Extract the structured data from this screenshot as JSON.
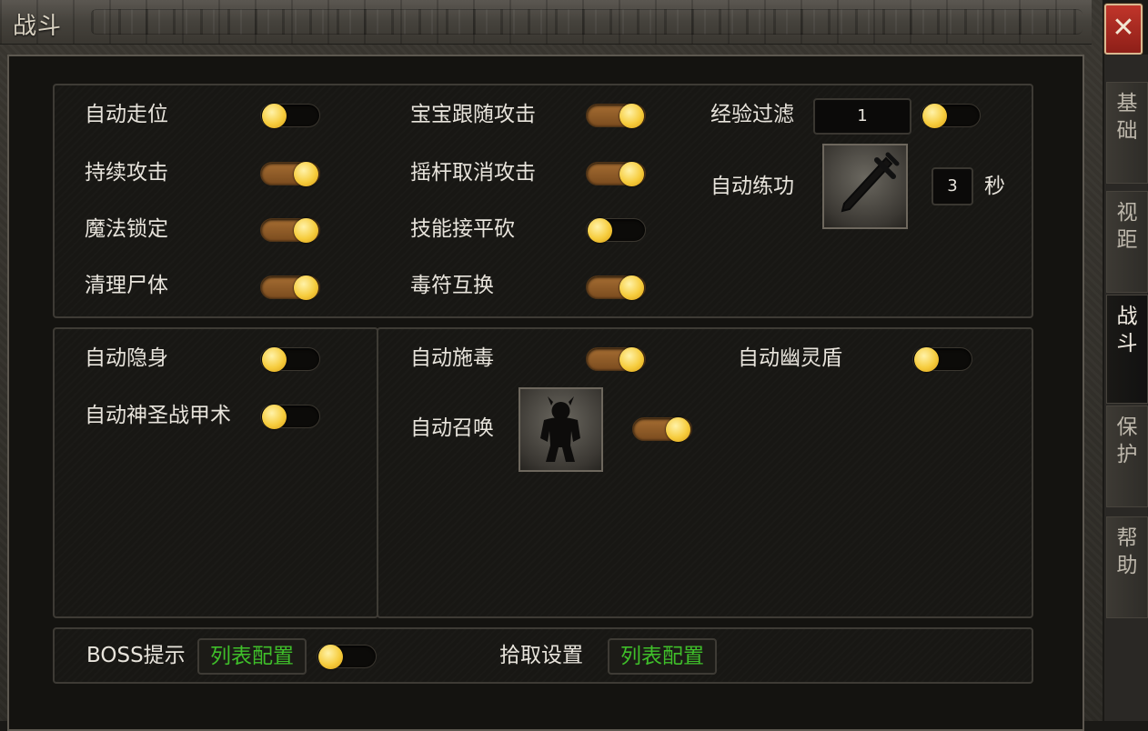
{
  "title": "战斗",
  "close_symbol": "✕",
  "side_tabs": [
    {
      "label": "基\n础",
      "active": false
    },
    {
      "label": "视\n距",
      "active": false
    },
    {
      "label": "战\n斗",
      "active": true
    },
    {
      "label": "保\n护",
      "active": false
    },
    {
      "label": "帮\n助",
      "active": false
    }
  ],
  "top_panel": {
    "col1": [
      {
        "label": "自动走位",
        "on": false
      },
      {
        "label": "持续攻击",
        "on": true
      },
      {
        "label": "魔法锁定",
        "on": true
      },
      {
        "label": "清理尸体",
        "on": true
      }
    ],
    "col2": [
      {
        "label": "宝宝跟随攻击",
        "on": true
      },
      {
        "label": "摇杆取消攻击",
        "on": true
      },
      {
        "label": "技能接平砍",
        "on": false
      },
      {
        "label": "毒符互换",
        "on": true
      }
    ],
    "exp_filter": {
      "label": "经验过滤",
      "value": "1",
      "on": false
    },
    "auto_train": {
      "label": "自动练功",
      "icon": "sword-icon",
      "seconds": "3",
      "unit": "秒"
    }
  },
  "middle_left": [
    {
      "label": "自动隐身",
      "on": false
    },
    {
      "label": "自动神圣战甲术",
      "on": false
    }
  ],
  "middle_right": {
    "poison": {
      "label": "自动施毒",
      "on": true
    },
    "ghost_shield": {
      "label": "自动幽灵盾",
      "on": false
    },
    "summon": {
      "label": "自动召唤",
      "icon": "skeleton-monster-icon",
      "on": true
    }
  },
  "bottom": {
    "boss_label": "BOSS提示",
    "boss_list_button": "列表配置",
    "boss_on": false,
    "pickup_label": "拾取设置",
    "pickup_list_button": "列表配置"
  },
  "colors": {
    "toggle_on": "#a56d32",
    "knob": "#f6cc3d",
    "list_text": "#3fbf2a",
    "close_bg": "#c0352a"
  }
}
